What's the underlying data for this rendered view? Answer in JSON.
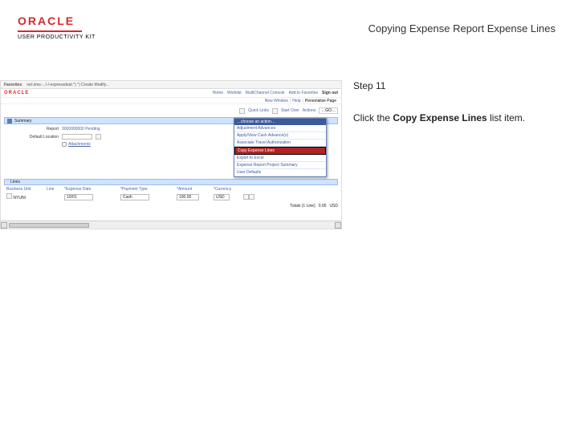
{
  "header": {
    "brand": "ORACLE",
    "product": "USER PRODUCTIVITY KIT",
    "page_title": "Copying Expense Report Expense Lines"
  },
  "guide": {
    "step_label": "Step 11",
    "instruction_prefix": "Click the ",
    "instruction_bold": "Copy Expense Lines",
    "instruction_suffix": " list item."
  },
  "screenshot": {
    "urlbar": {
      "title": "Favorites",
      "path": "oel-sms-.../-/-expressdeal.°) °) Create Modify..."
    },
    "appbar": {
      "brand": "ORACLE",
      "nav": [
        "Home",
        "Worklist",
        "MultiChannel Console",
        "Add to Favorites"
      ],
      "nav_last": "Sign out"
    },
    "breadcrumb": {
      "a": "New Window",
      "b": "Help",
      "c": "Personalize Page"
    },
    "toolbar": {
      "quick_links": "Quick Links",
      "start_over": "Start Over",
      "actions": "Actions",
      "actions_value": "…GO…"
    },
    "summary": {
      "title": "Summary",
      "report_label": "Report",
      "report_value": "3000000000 Pending",
      "loc_label": "Default Location",
      "loc_value": "",
      "attach_label": "Attachments"
    },
    "dropdown": {
      "head": "…choose an action…",
      "items": [
        "Adjustment Advances",
        "Apply/View Cash Advance(s)",
        "Associate Travel Authorization",
        "Copy Expense Lines",
        "Export to Excel",
        "Expense Report Project Summary",
        "User Defaults"
      ],
      "highlight_index": 3
    },
    "lines": {
      "head": "Lines",
      "cols": [
        "Business Unit",
        "Line",
        "*Expense Date",
        "*Payment Type",
        "*Amount",
        "*Currency"
      ],
      "row": {
        "bu": "NYUNI",
        "line": "",
        "date": "10/01",
        "ptype": "Cash",
        "amount": "100.00",
        "curr": "USD"
      },
      "totals_label": "Totals (1 Line)",
      "totals_values": [
        "0.00",
        "USD"
      ]
    }
  }
}
